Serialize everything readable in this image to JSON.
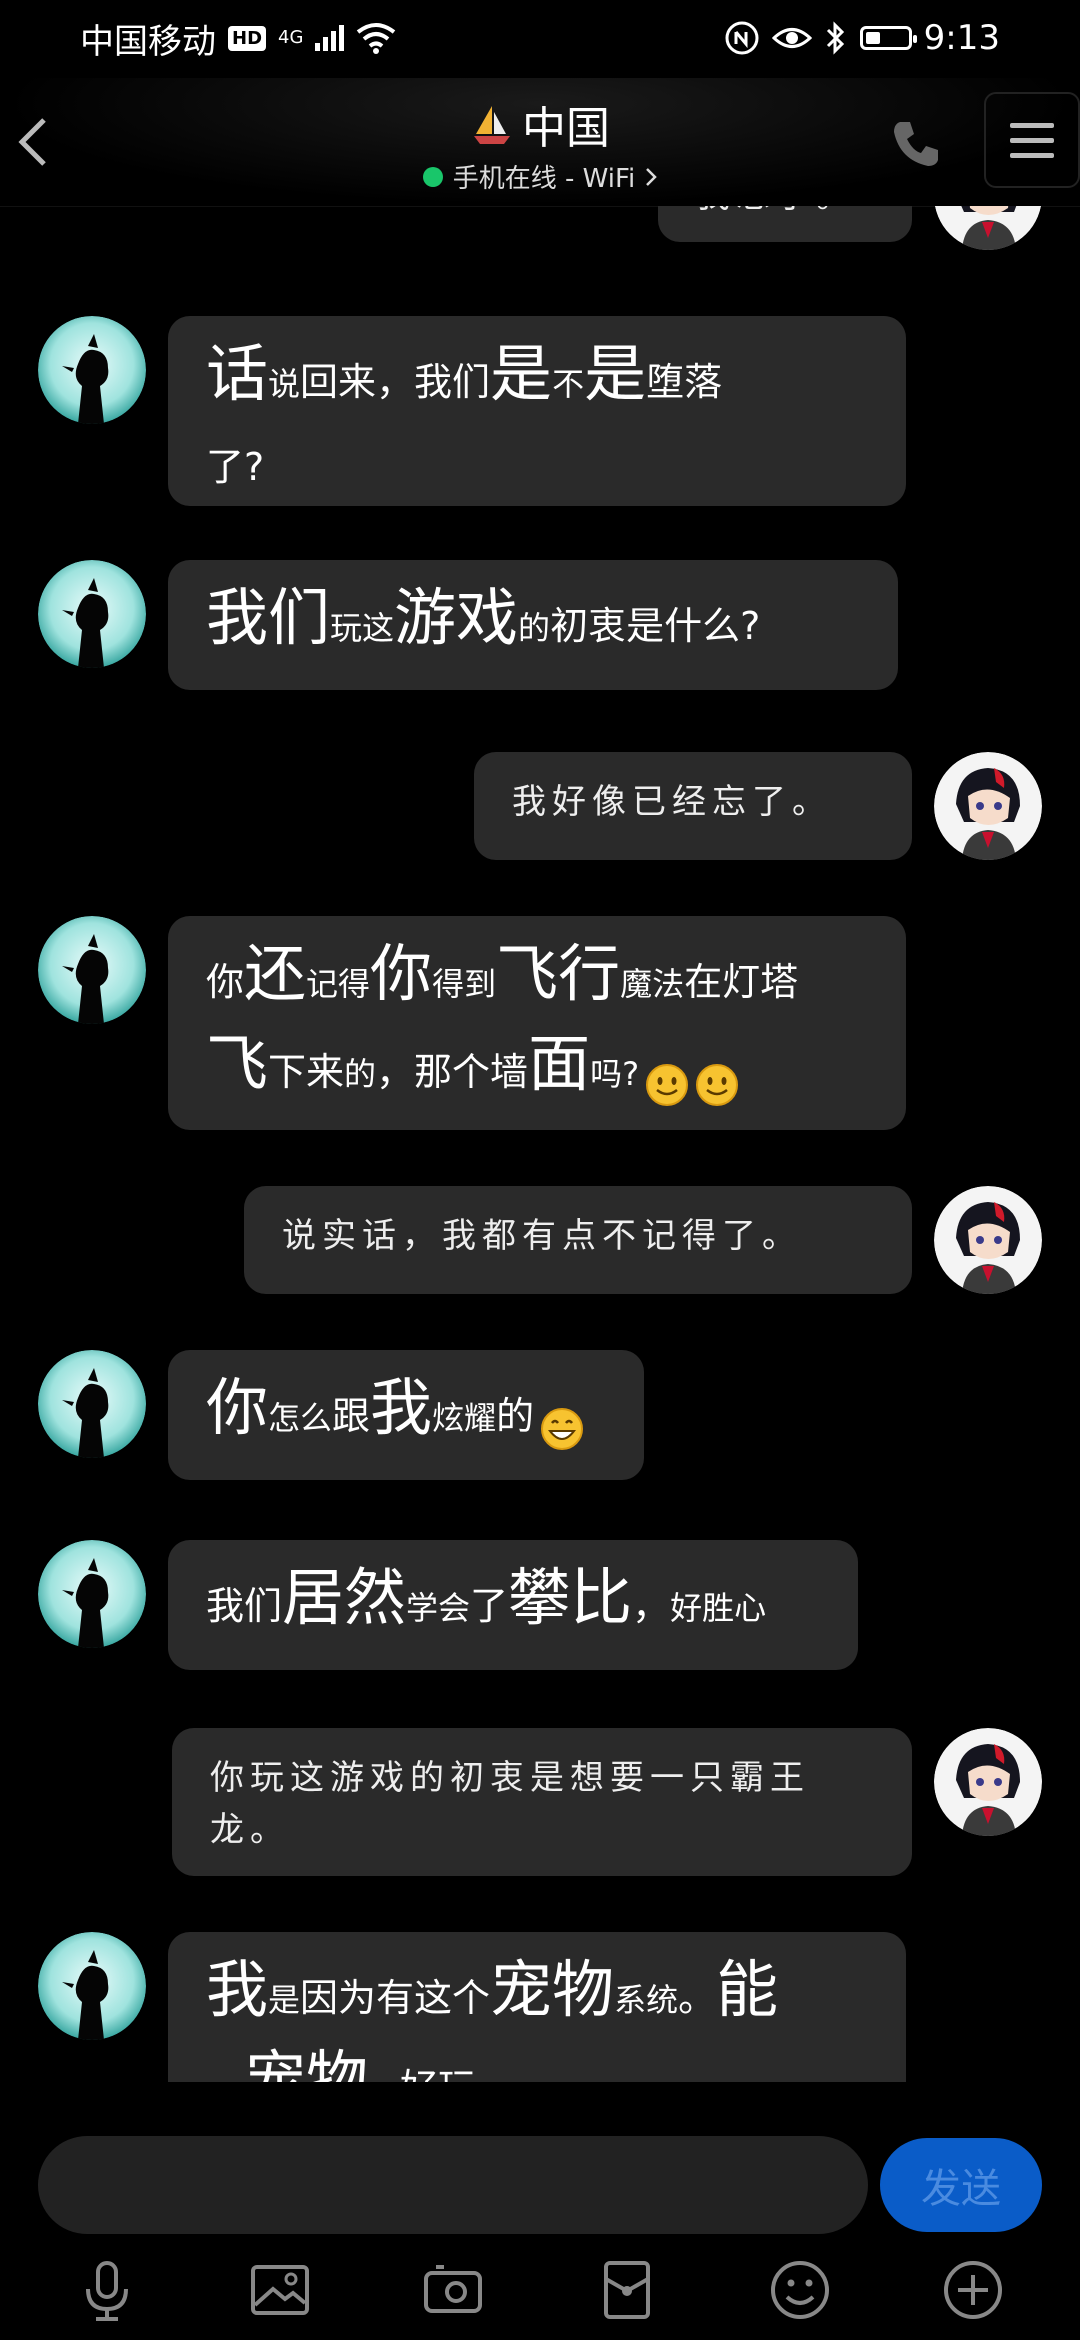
{
  "status_bar": {
    "carrier": "中国移动",
    "hd": "HD",
    "network": "4G",
    "time": "9:13",
    "battery_level": 0.35
  },
  "header": {
    "title": "中国",
    "online_status": "手机在线 - WiFi",
    "online_color": "#19c66a"
  },
  "messages": [
    {
      "dir": "out",
      "text": "我忘了。",
      "partial": true
    },
    {
      "dir": "in",
      "parts": [
        [
          "b",
          "话"
        ],
        [
          "s",
          "说"
        ],
        [
          "m",
          "回来，我们"
        ],
        [
          "b",
          "是"
        ],
        [
          "s",
          "不"
        ],
        [
          "b",
          "是"
        ],
        [
          "m",
          "堕落"
        ],
        [
          "br",
          ""
        ],
        [
          "m",
          "了?"
        ]
      ]
    },
    {
      "dir": "in",
      "parts": [
        [
          "b",
          "我们"
        ],
        [
          "s",
          "玩这"
        ],
        [
          "b",
          "游戏"
        ],
        [
          "s",
          "的"
        ],
        [
          "m",
          "初衷是什么?"
        ]
      ]
    },
    {
      "dir": "out",
      "text": "我好像已经忘了。"
    },
    {
      "dir": "in",
      "parts": [
        [
          "m",
          "你"
        ],
        [
          "b",
          "还"
        ],
        [
          "s",
          "记得"
        ],
        [
          "b",
          "你"
        ],
        [
          "s",
          "得到"
        ],
        [
          "b",
          "飞行"
        ],
        [
          "s",
          "魔法"
        ],
        [
          "m",
          "在灯塔"
        ],
        [
          "br",
          ""
        ],
        [
          "b",
          "飞"
        ],
        [
          "m",
          "下来"
        ],
        [
          "s",
          "的"
        ],
        [
          "m",
          "，那个墙"
        ],
        [
          "b",
          "面"
        ],
        [
          "s",
          "吗?"
        ]
      ],
      "emojis": [
        "slight-smile-emoji-icon",
        "slight-smile-emoji-icon"
      ]
    },
    {
      "dir": "out",
      "text": "说实话，我都有点不记得了。"
    },
    {
      "dir": "in",
      "parts": [
        [
          "b",
          "你"
        ],
        [
          "s",
          "怎么"
        ],
        [
          "m",
          "跟"
        ],
        [
          "b",
          "我"
        ],
        [
          "s",
          "炫耀"
        ],
        [
          "m",
          "的"
        ]
      ],
      "emojis": [
        "grin-emoji-icon"
      ]
    },
    {
      "dir": "in",
      "parts": [
        [
          "m",
          "我们"
        ],
        [
          "b",
          "居然"
        ],
        [
          "s",
          "学会"
        ],
        [
          "m",
          "了"
        ],
        [
          "b",
          "攀比"
        ],
        [
          "m",
          "，"
        ],
        [
          "s",
          "好胜心"
        ]
      ]
    },
    {
      "dir": "out",
      "text": "你玩这游戏的初衷是想要一只霸王龙。"
    },
    {
      "dir": "in",
      "parts": [
        [
          "b",
          "我"
        ],
        [
          "s",
          "是"
        ],
        [
          "m",
          "因为有这个"
        ],
        [
          "b",
          "宠物"
        ],
        [
          "s",
          "系统"
        ],
        [
          "m",
          "。"
        ],
        [
          "b",
          "能"
        ],
        [
          "br",
          ""
        ],
        [
          "m",
          "　"
        ],
        [
          "b",
          "宠物"
        ],
        [
          "s",
          "　"
        ],
        [
          "m",
          "好玩"
        ]
      ],
      "partial": true
    }
  ],
  "composer": {
    "placeholder": "",
    "value": "",
    "send_label": "发送"
  },
  "toolbar": [
    "microphone-icon",
    "image-icon",
    "camera-icon",
    "red-packet-icon",
    "emoji-icon",
    "plus-icon"
  ]
}
